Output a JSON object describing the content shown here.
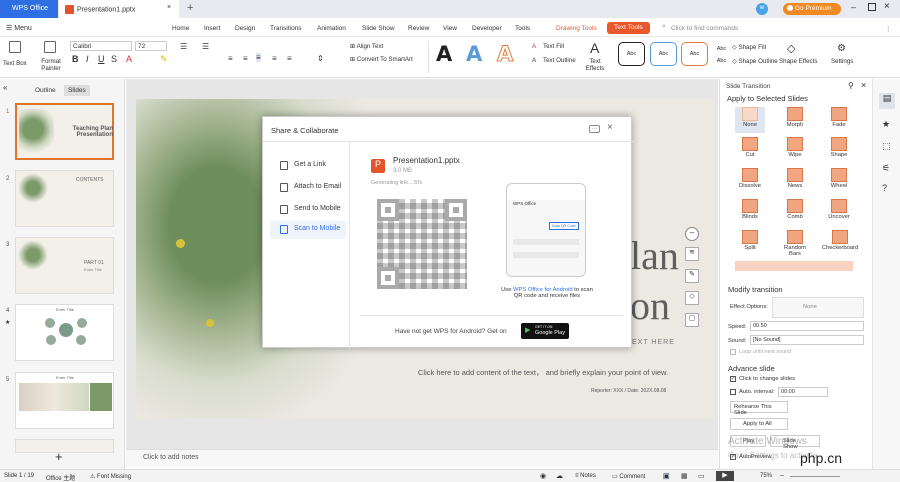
{
  "tabs": {
    "wps": "WPS Office",
    "doc": "Presentation1.pptx",
    "add": "+"
  },
  "topright": {
    "premium": "Go Premium",
    "avatar": "w"
  },
  "menubar": {
    "menu": "Menu",
    "items": [
      "Home",
      "Insert",
      "Design",
      "Transitions",
      "Animation",
      "Slide Show",
      "Review",
      "View",
      "Developer",
      "Tools"
    ],
    "drawing_tools": "Drawing Tools",
    "text_tools": "Text Tools",
    "search": "Click to find commands"
  },
  "ribbon": {
    "text_box": "Text Box",
    "format_painter": "Format Painter",
    "font": "Calibri",
    "size": "72",
    "align_text": "Align Text",
    "convert_smartart": "Convert To SmartArt",
    "text_fill": "Text Fill",
    "text_outline": "Text Outline",
    "text_effects": "Text Effects",
    "abc": [
      "Abc",
      "Abc",
      "Abc",
      "Abc",
      "Abc"
    ],
    "shape_fill": "Shape Fill",
    "shape_outline": "Shape Outline",
    "shape_effects": "Shape Effects",
    "settings": "Settings"
  },
  "leftpane": {
    "outline": "Outline",
    "slides": "Slides",
    "thumb1_title": "Teaching Plan Presentation",
    "thumb2_title": "CONTENTS",
    "thumb3_title": "PART 01",
    "thumb3_sub": "Enter Title",
    "thumb4_title": "Enter Title",
    "thumb5_title": "Enter Title",
    "slide_numbers": [
      "1",
      "2",
      "3",
      "4",
      "5"
    ],
    "add": "+"
  },
  "slide": {
    "title_frag1": "lan",
    "title_frag2": "on",
    "subtitle_frag": "EXT HERE",
    "content": "Click here to add content of the text， and briefly explain your point of view.",
    "reporter": "Reporter: XXX / Date: 202X.08.08"
  },
  "notes": "Click to add notes",
  "share": {
    "title": "Share & Collaborate",
    "options": [
      "Get a Link",
      "Attach to Email",
      "Send to Mobile",
      "Scan to Mobile"
    ],
    "filename": "Presentation1.pptx",
    "filesize": "3.0 MB",
    "status": "Generating link....5%",
    "phone_app": "WPS Office",
    "phone_button": "Scan QR Code",
    "caption_link": "WPS Office for Android",
    "caption_rest1": "Use",
    "caption_rest2": "to scan",
    "caption_line2": "QR code and receive files",
    "footer": "Have not get WPS for Android? Get on",
    "gplay_small": "GET IT ON",
    "gplay": "Google Play"
  },
  "transition": {
    "header": "Slide Transition",
    "apply_selected": "Apply to Selected Slides",
    "effects": [
      "None",
      "Morph",
      "Fade",
      "Cut",
      "Wipe",
      "Shape",
      "Dissolve",
      "News",
      "Wheel",
      "Blinds",
      "Comb",
      "Uncover",
      "Split",
      "Random Bars",
      "Checkerboard"
    ],
    "modify": "Modify transition",
    "effect_options_label": "Effect Options:",
    "effect_options_value": "None",
    "speed_label": "Speed:",
    "speed_value": "00.50",
    "sound_label": "Sound:",
    "sound_value": "[No Sound]",
    "loop": "Loop until next sound",
    "advance": "Advance slide",
    "on_click": "Click to change slides",
    "auto": "Auto.  interval:",
    "auto_value": "00:00",
    "rehearse": "Rehearse This Slide",
    "apply_all": "Apply to All",
    "play": "Play",
    "slideshow": "Slide Show",
    "autopreview": "AutoPreview",
    "activate1": "Activate Windows",
    "activate2": "Go to Settings to activate"
  },
  "status": {
    "slide": "Slide 1 / 19",
    "theme": "Office 主题",
    "font_missing": "Font Missing",
    "notes": "Notes",
    "comment": "Comment",
    "zoom": "75%"
  },
  "watermark": "php.cn",
  "colors": {
    "accent": "#2f6fe4",
    "ppt": "#e2552a",
    "text_tools": "#e9572a",
    "premium": "#f08a24"
  }
}
